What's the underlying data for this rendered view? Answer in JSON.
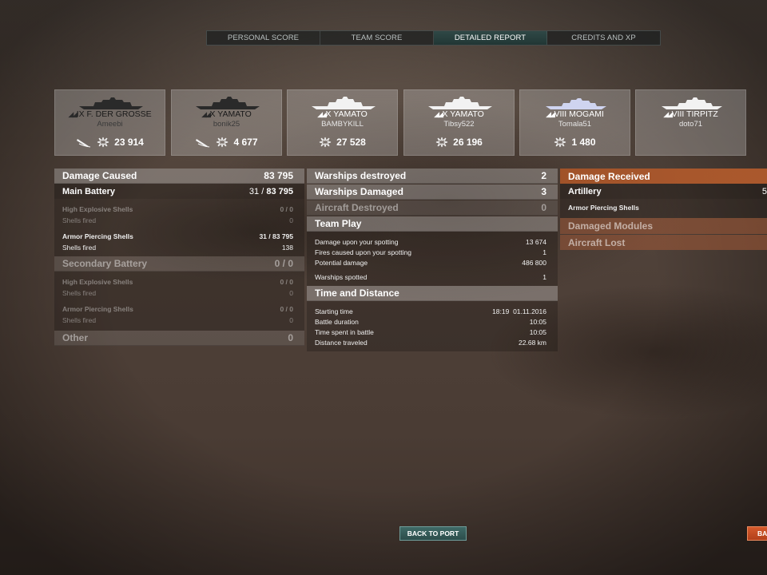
{
  "tabs": [
    {
      "label": "PERSONAL SCORE",
      "active": false
    },
    {
      "label": "TEAM SCORE",
      "active": false
    },
    {
      "label": "DETAILED REPORT",
      "active": true
    },
    {
      "label": "CREDITS AND XP",
      "active": false
    }
  ],
  "cards": [
    {
      "ship": "IX F. DER GROßE",
      "player": "Ameebi",
      "damage": "23 914",
      "icon": "ship-silhouette-icon",
      "sunk": true
    },
    {
      "ship": "X YAMATO",
      "player": "bonik25",
      "damage": "4 677",
      "icon": "ship-silhouette-icon",
      "sunk": true
    },
    {
      "ship": "X YAMATO",
      "player": "BAMBYKILL",
      "damage": "27 528",
      "icon": "ship-silhouette-icon",
      "sunk": false
    },
    {
      "ship": "X YAMATO",
      "player": "Tibsy522",
      "damage": "26 196",
      "icon": "ship-silhouette-icon",
      "sunk": false
    },
    {
      "ship": "VIII MOGAMI",
      "player": "Tomala51",
      "damage": "1 480",
      "icon": "ship-silhouette-icon",
      "sunk": false
    },
    {
      "ship": "VIII TIRPITZ",
      "player": "doto71",
      "damage": "",
      "icon": "ship-silhouette-icon",
      "sunk": false
    }
  ],
  "damage_caused": {
    "title": "Damage Caused",
    "total": "83 795",
    "main_battery": {
      "label": "Main Battery",
      "hits": "31",
      "damage": "83 795"
    },
    "he_label": "High Explosive Shells",
    "he_hits": "0",
    "he_damage": "0",
    "he_fired_label": "Shells fired",
    "he_fired": "0",
    "ap_label": "Armor Piercing Shells",
    "ap_hits": "31",
    "ap_damage": "83 795",
    "ap_fired_label": "Shells fired",
    "ap_fired": "138",
    "secondary": {
      "label": "Secondary Battery",
      "hits": "0",
      "damage": "0"
    },
    "sec_he_label": "High Explosive Shells",
    "sec_he_hits": "0",
    "sec_he_damage": "0",
    "sec_he_fired_label": "Shells fired",
    "sec_he_fired": "0",
    "sec_ap_label": "Armor Piercing Shells",
    "sec_ap_hits": "0",
    "sec_ap_damage": "0",
    "sec_ap_fired_label": "Shells fired",
    "sec_ap_fired": "0",
    "other_label": "Other",
    "other_value": "0"
  },
  "middle": {
    "destroyed_label": "Warships destroyed",
    "destroyed": "2",
    "damaged_label": "Warships Damaged",
    "damaged": "3",
    "aircraft_label": "Aircraft Destroyed",
    "aircraft": "0",
    "team_play": "Team Play",
    "spotting_dmg_label": "Damage upon your spotting",
    "spotting_dmg": "13 674",
    "fires_label": "Fires caused upon your spotting",
    "fires": "1",
    "potential_label": "Potential damage",
    "potential": "486 800",
    "spotted_label": "Warships spotted",
    "spotted": "1",
    "time_distance": "Time and Distance",
    "start_label": "Starting time",
    "start_time": "18:19",
    "start_date": "01.11.2016",
    "duration_label": "Battle duration",
    "duration": "10:05",
    "time_in_label": "Time spent in battle",
    "time_in": "10:05",
    "distance_label": "Distance traveled",
    "distance": "22.68 km"
  },
  "right": {
    "received_label": "Damage Received",
    "artillery_label": "Artillery",
    "artillery_value": "5",
    "ap_label": "Armor Piercing Shells",
    "modules_label": "Damaged Modules",
    "aircraft_lost_label": "Aircraft Lost"
  },
  "buttons": {
    "back_to_port": "BACK TO PORT",
    "back_red": "BA"
  }
}
